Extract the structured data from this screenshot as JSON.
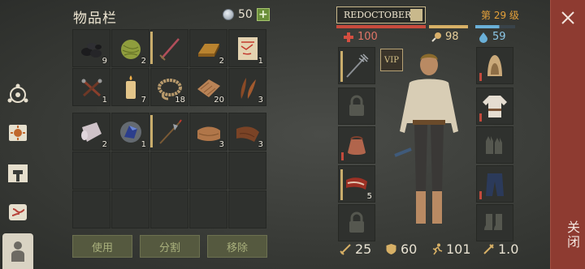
{
  "inventory": {
    "title": "物品栏",
    "coins": "50",
    "plus_label": "+",
    "slots": [
      {
        "icon": "coal-icon",
        "qty": "9"
      },
      {
        "icon": "plant-fiber-ball-icon",
        "qty": "2"
      },
      {
        "icon": "sword-icon",
        "qty": ""
      },
      {
        "icon": "bronze-ingot-icon",
        "qty": "2"
      },
      {
        "icon": "treasure-map-icon",
        "qty": "1"
      },
      {
        "icon": "nails-icon",
        "qty": "1"
      },
      {
        "icon": "candle-icon",
        "qty": "7"
      },
      {
        "icon": "rope-icon",
        "qty": "18"
      },
      {
        "icon": "cloth-icon",
        "qty": "20"
      },
      {
        "icon": "feathers-icon",
        "qty": "3"
      },
      {
        "icon": "paper-roll-icon",
        "qty": "2"
      },
      {
        "icon": "blue-crystal-icon",
        "qty": "1"
      },
      {
        "icon": "halberd-icon",
        "qty": ""
      },
      {
        "icon": "leather-icon",
        "qty": "3"
      },
      {
        "icon": "tanned-leather-icon",
        "qty": "3"
      }
    ],
    "actions": {
      "use": "使用",
      "split": "分割",
      "move": "移除"
    }
  },
  "character": {
    "name": "REDOCTOBER",
    "level": "第 29 级",
    "health": "100",
    "hunger": "98",
    "thirst": "59",
    "vip": "VIP",
    "left_slots": [
      {
        "icon": "trident-icon",
        "qty": ""
      },
      {
        "icon": "lock-icon",
        "qty": ""
      },
      {
        "icon": "pouch-icon",
        "qty": ""
      },
      {
        "icon": "meat-icon",
        "qty": "5"
      },
      {
        "icon": "lock-icon",
        "qty": ""
      }
    ],
    "right_slots": [
      {
        "icon": "hood-icon"
      },
      {
        "icon": "shirt-icon"
      },
      {
        "icon": "gloves-icon"
      },
      {
        "icon": "pants-icon"
      },
      {
        "icon": "boots-icon"
      }
    ],
    "stats": {
      "attack": "25",
      "defense": "60",
      "speed": "101",
      "weight": "1.0"
    }
  },
  "close": {
    "label": "关闭"
  },
  "colors": {
    "health": "#c84a3c",
    "hunger": "#d7b066",
    "thirst": "#6ab0d8",
    "level": "#e5a13a",
    "close_bg": "#8e3b31"
  }
}
